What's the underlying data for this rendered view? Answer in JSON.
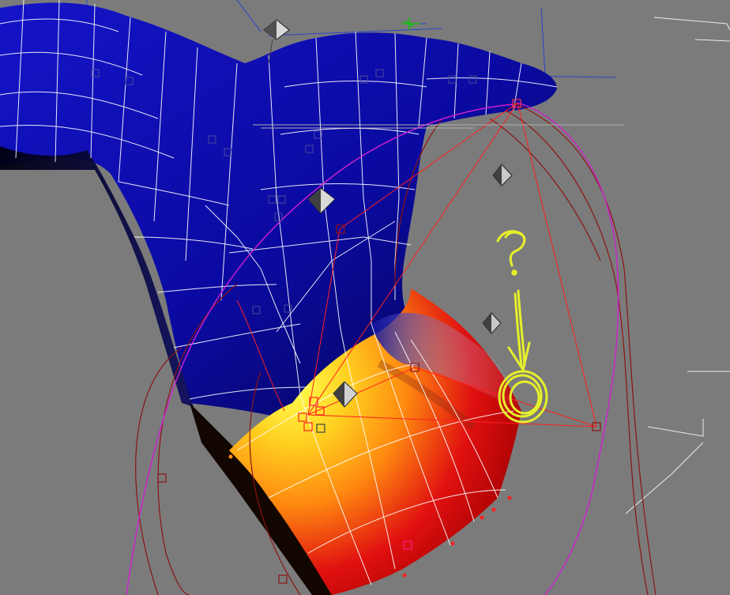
{
  "viewport": {
    "background_color": "#7b7b7b",
    "mesh_color": "#0a0aa0",
    "wire_color": "#ffffff",
    "envelope_outer_color": "#8b1414",
    "envelope_inner_color": "#d020d0",
    "bone_line_color": "#ff2020",
    "weight_gradient": [
      "#ffff40",
      "#ff9a10",
      "#e01010",
      "#b00000"
    ],
    "annotation_color": "#e6f02a",
    "annotation_text": "?",
    "annotation_icon": "question-mark-arrow-circle",
    "bone_object_icon": "octahedron-bone-icon",
    "helper_grid_color": "#ffffff",
    "helper_axis_color": "#2a44c8"
  }
}
